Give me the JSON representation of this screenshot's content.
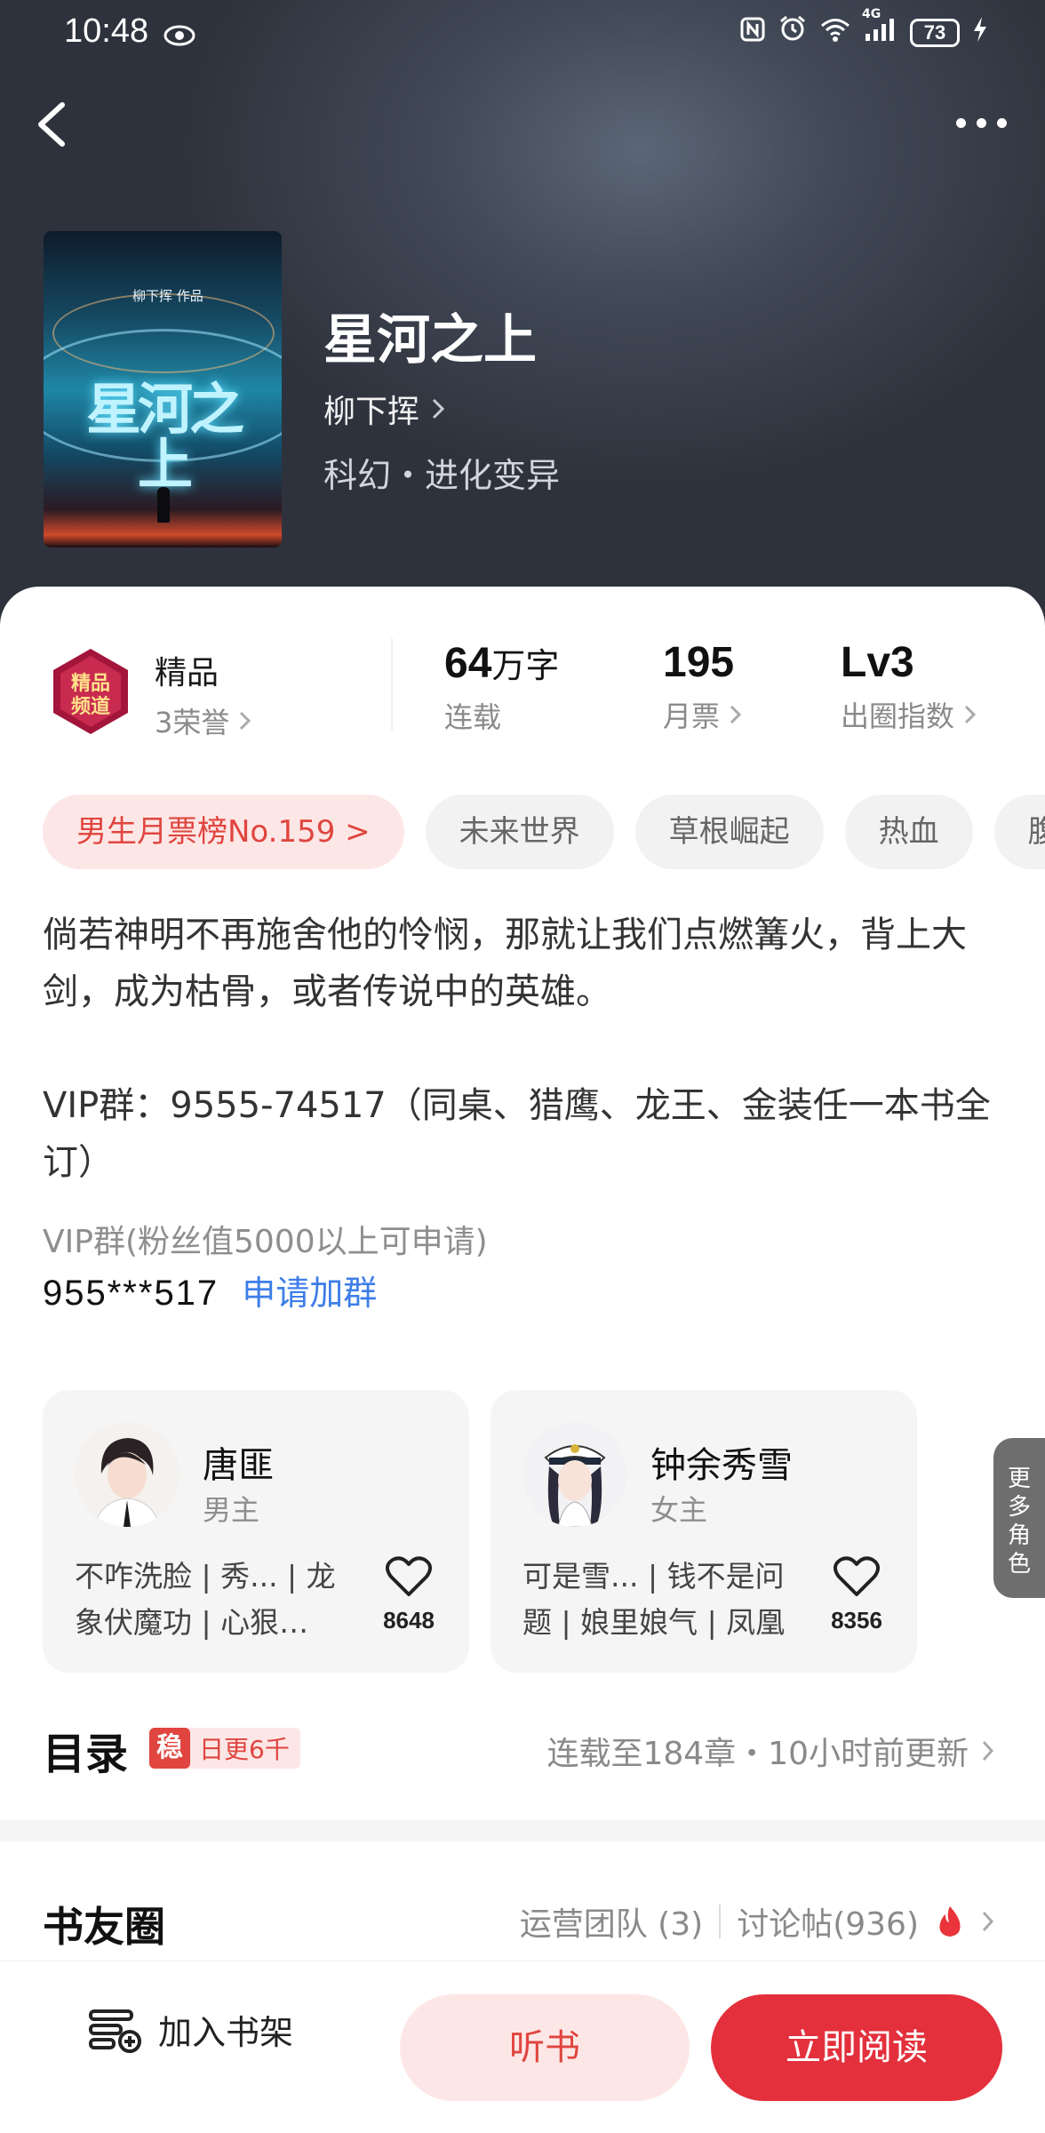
{
  "status_bar": {
    "time": "10:48",
    "network": "4G",
    "battery": "73"
  },
  "book": {
    "title": "星河之上",
    "author": "柳下挥",
    "genre": "科幻・进化变异",
    "cover_author": "柳下挥 作品",
    "cover_title": "星河之上"
  },
  "stats": {
    "quality_label": "精品",
    "quality_sub": "3荣誉",
    "word_count": "64",
    "word_unit": "万字",
    "status": "连载",
    "monthly_tickets": "195",
    "monthly_tickets_label": "月票",
    "level": "Lv3",
    "level_label": "出圈指数"
  },
  "tags": [
    {
      "label": "男生月票榜No.159 >",
      "hot": true
    },
    {
      "label": "未来世界",
      "hot": false
    },
    {
      "label": "草根崛起",
      "hot": false
    },
    {
      "label": "热血",
      "hot": false
    },
    {
      "label": "腹",
      "hot": false
    }
  ],
  "description": {
    "line1": "倘若神明不再施舍他的怜悯，那就让我们点燃篝火，背上大剑，成为枯骨，或者传说中的英雄。",
    "line2": "VIP群：9555-74517（同桌、猎鹰、龙王、金装任一本书全订）",
    "vip_note": "VIP群(粉丝值5000以上可申请)",
    "vip_number": "955***517",
    "join_link": "申请加群"
  },
  "roles": [
    {
      "name": "唐匪",
      "type": "男主",
      "desc": "不咋洗脸 | 秀... | 龙象伏魔功 | 心狠…",
      "likes": "8648"
    },
    {
      "name": "钟余秀雪",
      "type": "女主",
      "desc": "可是雪... | 钱不是问题 | 娘里娘气 | 凤凰",
      "likes": "8356"
    }
  ],
  "more_roles": [
    "更",
    "多",
    "角",
    "色"
  ],
  "toc": {
    "title": "目录",
    "badge_mark": "稳",
    "badge_text": "日更6千",
    "info": "连载至184章・10小时前更新"
  },
  "club": {
    "title": "书友圈",
    "team": "运营团队 (3)",
    "posts": "讨论帖(936)"
  },
  "bottom": {
    "shelf": "加入书架",
    "listen": "听书",
    "read": "立即阅读"
  },
  "colors": {
    "accent": "#e3303c",
    "accent_light": "#fde7e6",
    "link": "#3d7ee8"
  }
}
